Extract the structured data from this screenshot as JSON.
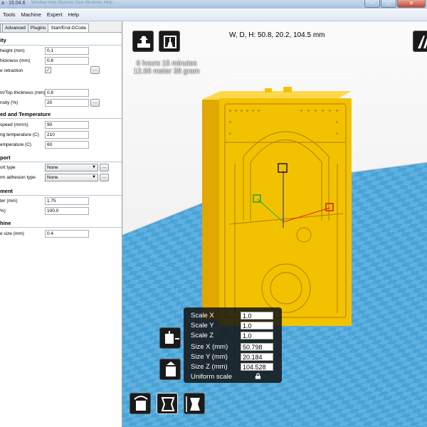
{
  "window": {
    "title": "a - 15.04.6",
    "ghost_menu": "Window  Help  Mascots  View  Windows  Help"
  },
  "menubar": {
    "items": [
      "Tools",
      "Machine",
      "Expert",
      "Help"
    ]
  },
  "tabs": [
    "Advanced",
    "Plugins",
    "Start/End-GCode"
  ],
  "form": {
    "sec_quality": "ity",
    "layer_height_label": "height (mm)",
    "layer_height": "0.1",
    "shell_thickness_label": "hickness (mm)",
    "shell_thickness": "0.8",
    "retraction_label": "e retraction",
    "retraction_checked": true,
    "btn_dots": "...",
    "bottom_top_label": "m/Top thickness (mm)",
    "bottom_top": "0.8",
    "fill_density_label": "nsity (%)",
    "fill_density": "20",
    "sec_speed": "ed and Temperature",
    "print_speed_label": "speed (mm/s)",
    "print_speed": "90",
    "print_temp_label": "ng temperature (C)",
    "print_temp": "210",
    "bed_temp_label": "emperature (C)",
    "bed_temp": "60",
    "sec_support": "port",
    "support_type_label": "ort type",
    "support_type": "None",
    "adhesion_label": "rm adhesion type",
    "adhesion": "None",
    "sec_filament": "ment",
    "diameter_label": "ter (mm)",
    "diameter": "1.75",
    "flow_label": "%)",
    "flow": "100.0",
    "sec_machine": "hine",
    "nozzle_label": "e size (mm)",
    "nozzle": "0.4"
  },
  "viewport": {
    "print_time": "6 hours 15 minutes",
    "print_material": "12.66 meter 38 gram",
    "dimensions": "W, D, H: 50.8, 20.2, 104.5 mm",
    "floor_color": "#5fb2e0",
    "model_color": "#f2c200"
  },
  "scale_panel": {
    "scale_x_label": "Scale X",
    "scale_x": "1.0",
    "scale_y_label": "Scale Y",
    "scale_y": "1.0",
    "scale_z_label": "Scale Z",
    "scale_z": "1.0",
    "size_x_label": "Size X (mm)",
    "size_x": "50.798",
    "size_y_label": "Size Y (mm)",
    "size_y": "20.184",
    "size_z_label": "Size Z (mm)",
    "size_z": "104.528",
    "uniform_label": "Uniform scale"
  },
  "icons": [
    "load-icon",
    "print-icon",
    "view-mode-icon",
    "lay-flat-icon",
    "reset-scale-icon",
    "scale-to-max-icon",
    "rotate-icon",
    "scale-icon",
    "mirror-icon",
    "lock-icon"
  ]
}
